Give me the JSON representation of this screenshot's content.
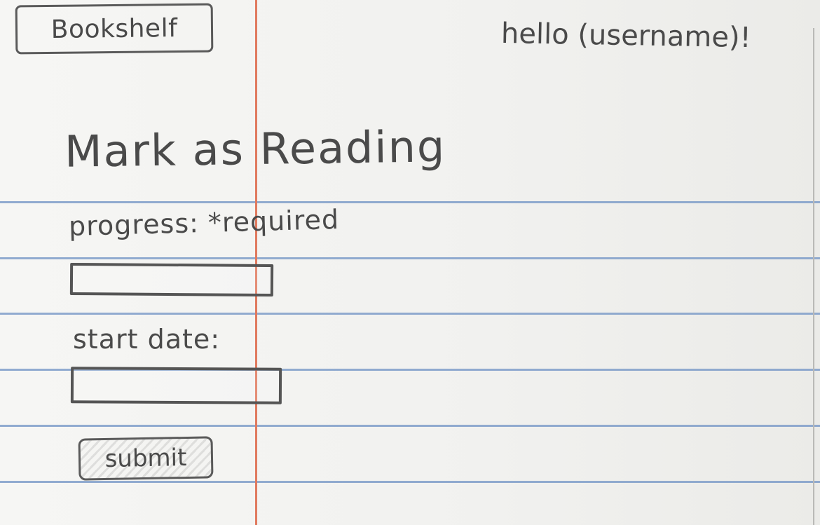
{
  "header": {
    "logo_text": "Bookshelf",
    "greeting": "hello (username)!"
  },
  "main": {
    "title": "Mark as Reading"
  },
  "form": {
    "progress_label": "progress: *required",
    "progress_value": "",
    "start_date_label": "start date:",
    "start_date_value": "",
    "submit_label": "submit"
  },
  "colors": {
    "ruled_line": "#7f9dc9",
    "margin_line": "#e07a5f",
    "pencil": "#4a4a4a"
  }
}
